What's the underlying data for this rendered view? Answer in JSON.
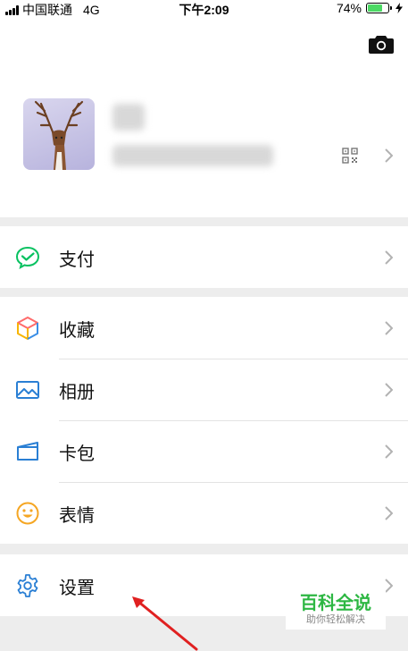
{
  "status_bar": {
    "carrier": "中国联通",
    "network": "4G",
    "time": "下午2:09",
    "battery": "74%",
    "battery_level": 0.74,
    "battery_color": "#4cd964"
  },
  "profile": {
    "camera_icon": "camera-icon",
    "qr_icon": "qr-code-icon"
  },
  "menu": {
    "pay": {
      "label": "支付",
      "icon": "pay-icon",
      "color": "#07c160"
    },
    "favorites": {
      "label": "收藏",
      "icon": "favorites-cube-icon"
    },
    "album": {
      "label": "相册",
      "icon": "album-icon",
      "color": "#2a7fd4"
    },
    "cards": {
      "label": "卡包",
      "icon": "card-wallet-icon",
      "color": "#2a7fd4"
    },
    "stickers": {
      "label": "表情",
      "icon": "smiley-icon",
      "color": "#f5a623"
    },
    "settings": {
      "label": "设置",
      "icon": "gear-icon",
      "color": "#2a7fd4"
    }
  },
  "watermark": {
    "title": "百科全说",
    "subtitle": "助你轻松解决",
    "color": "#2db743"
  },
  "annotation": {
    "arrow_color": "#e02020"
  }
}
